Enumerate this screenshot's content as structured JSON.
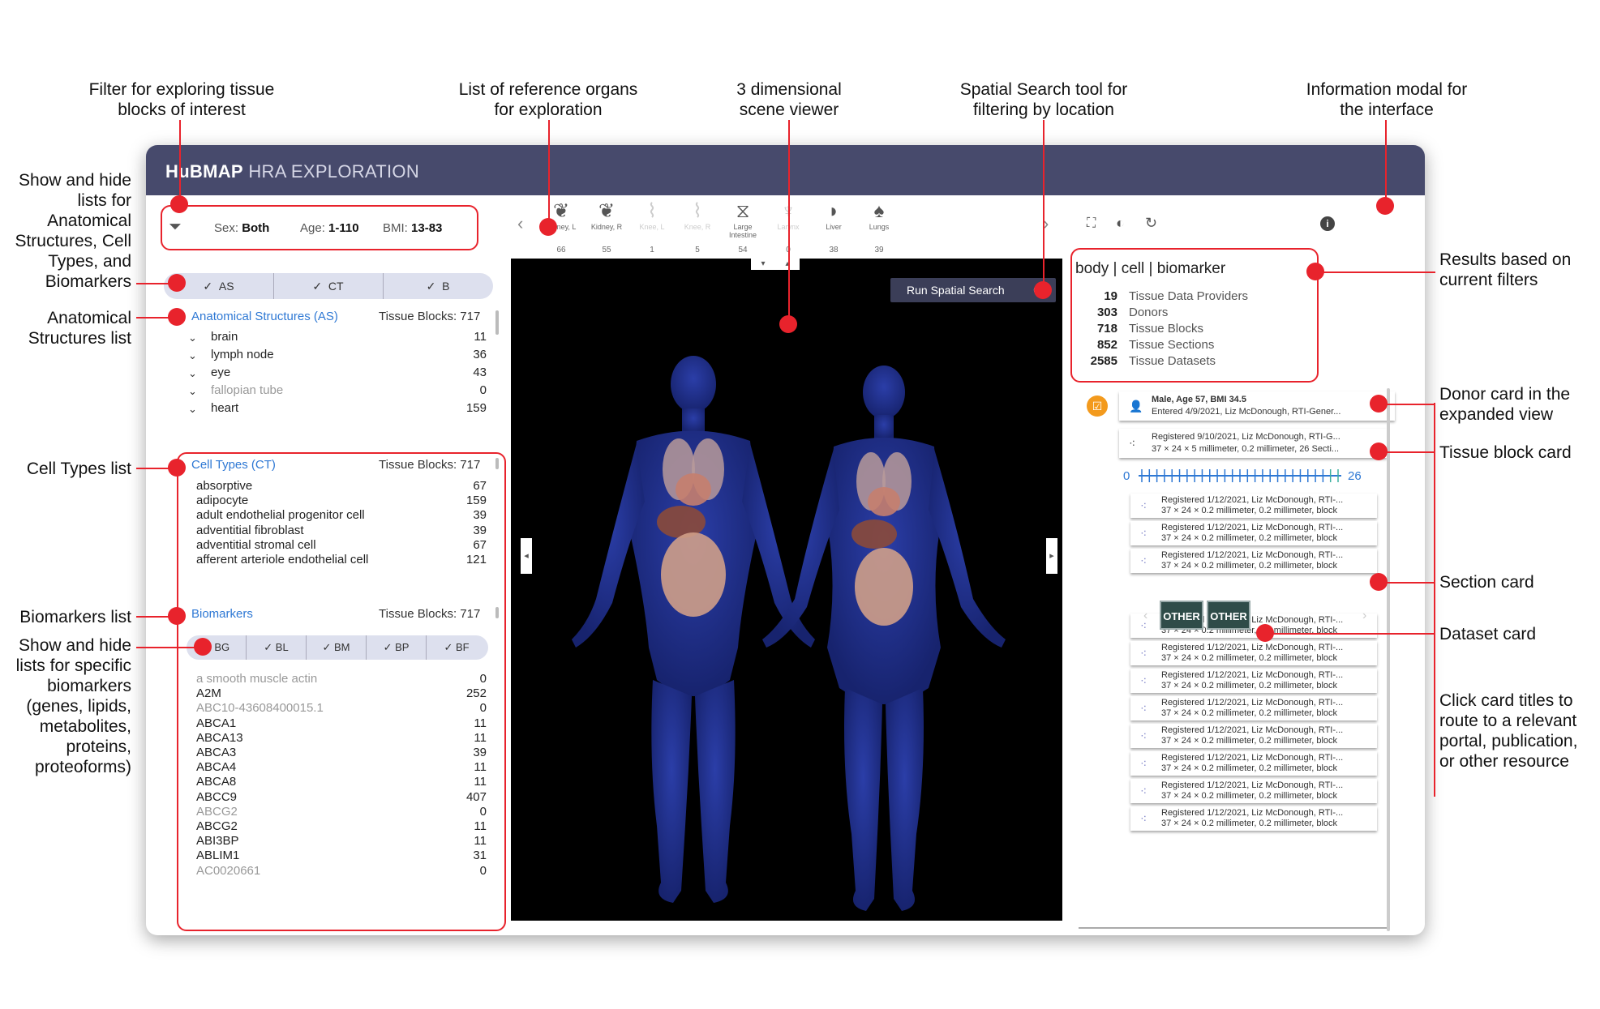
{
  "annotations": {
    "filter": "Filter for exploring tissue\nblocks of interest",
    "organs": "List of reference organs\nfor exploration",
    "viewer": "3 dimensional\nscene viewer",
    "spatial": "Spatial Search tool for\nfiltering by location",
    "info": "Information modal for\nthe interface",
    "show_hide_lists": "Show and hide\nlists for\nAnatomical\nStructures, Cell\nTypes, and\nBiomarkers",
    "as_list": "Anatomical\nStructures list",
    "ct_list": "Cell Types list",
    "bm_list": "Biomarkers list",
    "show_hide_bm": "Show and hide\nlists for specific\nbiomarkers\n(genes, lipids,\nmetabolites,\nproteins,\nproteoforms)",
    "results": "Results based on\ncurrent filters",
    "donor_card": "Donor card in the\nexpanded view",
    "tissue_card": "Tissue block card",
    "section_card": "Section card",
    "dataset_card": "Dataset card",
    "click_titles": "Click card titles to\nroute to a relevant\nportal, publication,\nor other resource"
  },
  "app": {
    "brand_bold": "HuBMAP",
    "brand_rest": "HRA EXPLORATION"
  },
  "filters": {
    "sex_label": "Sex:",
    "sex": "Both",
    "age_label": "Age:",
    "age": "1-110",
    "bmi_label": "BMI:",
    "bmi": "13-83"
  },
  "list_toggle": [
    "AS",
    "CT",
    "B"
  ],
  "organs": [
    {
      "name": "Kidney, L",
      "count": "66",
      "icon": "kidney-icon",
      "glyph": "❦",
      "dim": false
    },
    {
      "name": "Kidney, R",
      "count": "55",
      "icon": "kidney-icon",
      "glyph": "❦",
      "dim": false
    },
    {
      "name": "Knee, L",
      "count": "1",
      "icon": "knee-icon",
      "glyph": "⌇",
      "dim": true
    },
    {
      "name": "Knee, R",
      "count": "5",
      "icon": "knee-icon",
      "glyph": "⌇",
      "dim": true
    },
    {
      "name": "Large Intestine",
      "count": "54",
      "icon": "large-intestine-icon",
      "glyph": "⧖",
      "dim": false
    },
    {
      "name": "Larynx",
      "count": "0",
      "icon": "larynx-icon",
      "glyph": "♆",
      "dim": true
    },
    {
      "name": "Liver",
      "count": "38",
      "icon": "liver-icon",
      "glyph": "◗",
      "dim": false
    },
    {
      "name": "Lungs",
      "count": "39",
      "icon": "lungs-icon",
      "glyph": "♠",
      "dim": false
    }
  ],
  "anatomical": {
    "title": "Anatomical Structures (AS)",
    "blocks": "Tissue Blocks: 717",
    "items": [
      {
        "name": "brain",
        "count": "11"
      },
      {
        "name": "lymph node",
        "count": "36"
      },
      {
        "name": "eye",
        "count": "43"
      },
      {
        "name": "fallopian tube",
        "count": "0"
      },
      {
        "name": "heart",
        "count": "159"
      }
    ]
  },
  "cell_types": {
    "title": "Cell Types (CT)",
    "blocks": "Tissue Blocks: 717",
    "items": [
      {
        "name": "absorptive",
        "count": "67"
      },
      {
        "name": "adipocyte",
        "count": "159"
      },
      {
        "name": "adult endothelial progenitor cell",
        "count": "39"
      },
      {
        "name": "adventitial fibroblast",
        "count": "39"
      },
      {
        "name": "adventitial stromal cell",
        "count": "67"
      },
      {
        "name": "afferent arteriole endothelial cell",
        "count": "121"
      }
    ]
  },
  "biomarkers": {
    "title": "Biomarkers",
    "blocks": "Tissue Blocks: 717",
    "toggles": [
      "BG",
      "BL",
      "BM",
      "BP",
      "BF"
    ],
    "items": [
      {
        "name": "a smooth muscle actin",
        "count": "0"
      },
      {
        "name": "A2M",
        "count": "252"
      },
      {
        "name": "ABC10-43608400015.1",
        "count": "0"
      },
      {
        "name": "ABCA1",
        "count": "11"
      },
      {
        "name": "ABCA13",
        "count": "11"
      },
      {
        "name": "ABCA3",
        "count": "39"
      },
      {
        "name": "ABCA4",
        "count": "11"
      },
      {
        "name": "ABCA8",
        "count": "11"
      },
      {
        "name": "ABCC9",
        "count": "407"
      },
      {
        "name": "ABCG2",
        "count": "0"
      },
      {
        "name": "ABCG2",
        "count": "11"
      },
      {
        "name": "ABI3BP",
        "count": "11"
      },
      {
        "name": "ABLIM1",
        "count": "31"
      },
      {
        "name": "AC0020661",
        "count": "0"
      }
    ]
  },
  "spatial_button": "Run Spatial Search",
  "results": {
    "header": [
      "body",
      "cell",
      "biomarker"
    ],
    "rows": [
      {
        "count": "19",
        "label": "Tissue Data Providers"
      },
      {
        "count": "303",
        "label": "Donors"
      },
      {
        "count": "718",
        "label": "Tissue Blocks"
      },
      {
        "count": "852",
        "label": "Tissue Sections"
      },
      {
        "count": "2585",
        "label": "Tissue Datasets"
      }
    ]
  },
  "donor_card": {
    "line1": "Male, Age 57, BMI 34.5",
    "line2": "Entered 4/9/2021, Liz McDonough, RTI-Gener..."
  },
  "tissue_card": {
    "line1": "Registered 9/10/2021, Liz McDonough, RTI-G...",
    "line2": "37 × 24 × 5 millimeter, 0.2 millimeter, 26 Secti...",
    "slider_min": "0",
    "slider_max": "26"
  },
  "section_card": {
    "line1": "Registered 1/12/2021, Liz McDonough, RTI-...",
    "line2": "37 × 24 × 0.2 millimeter, 0.2 millimeter, block"
  },
  "datasets": [
    "OTHER",
    "OTHER"
  ]
}
